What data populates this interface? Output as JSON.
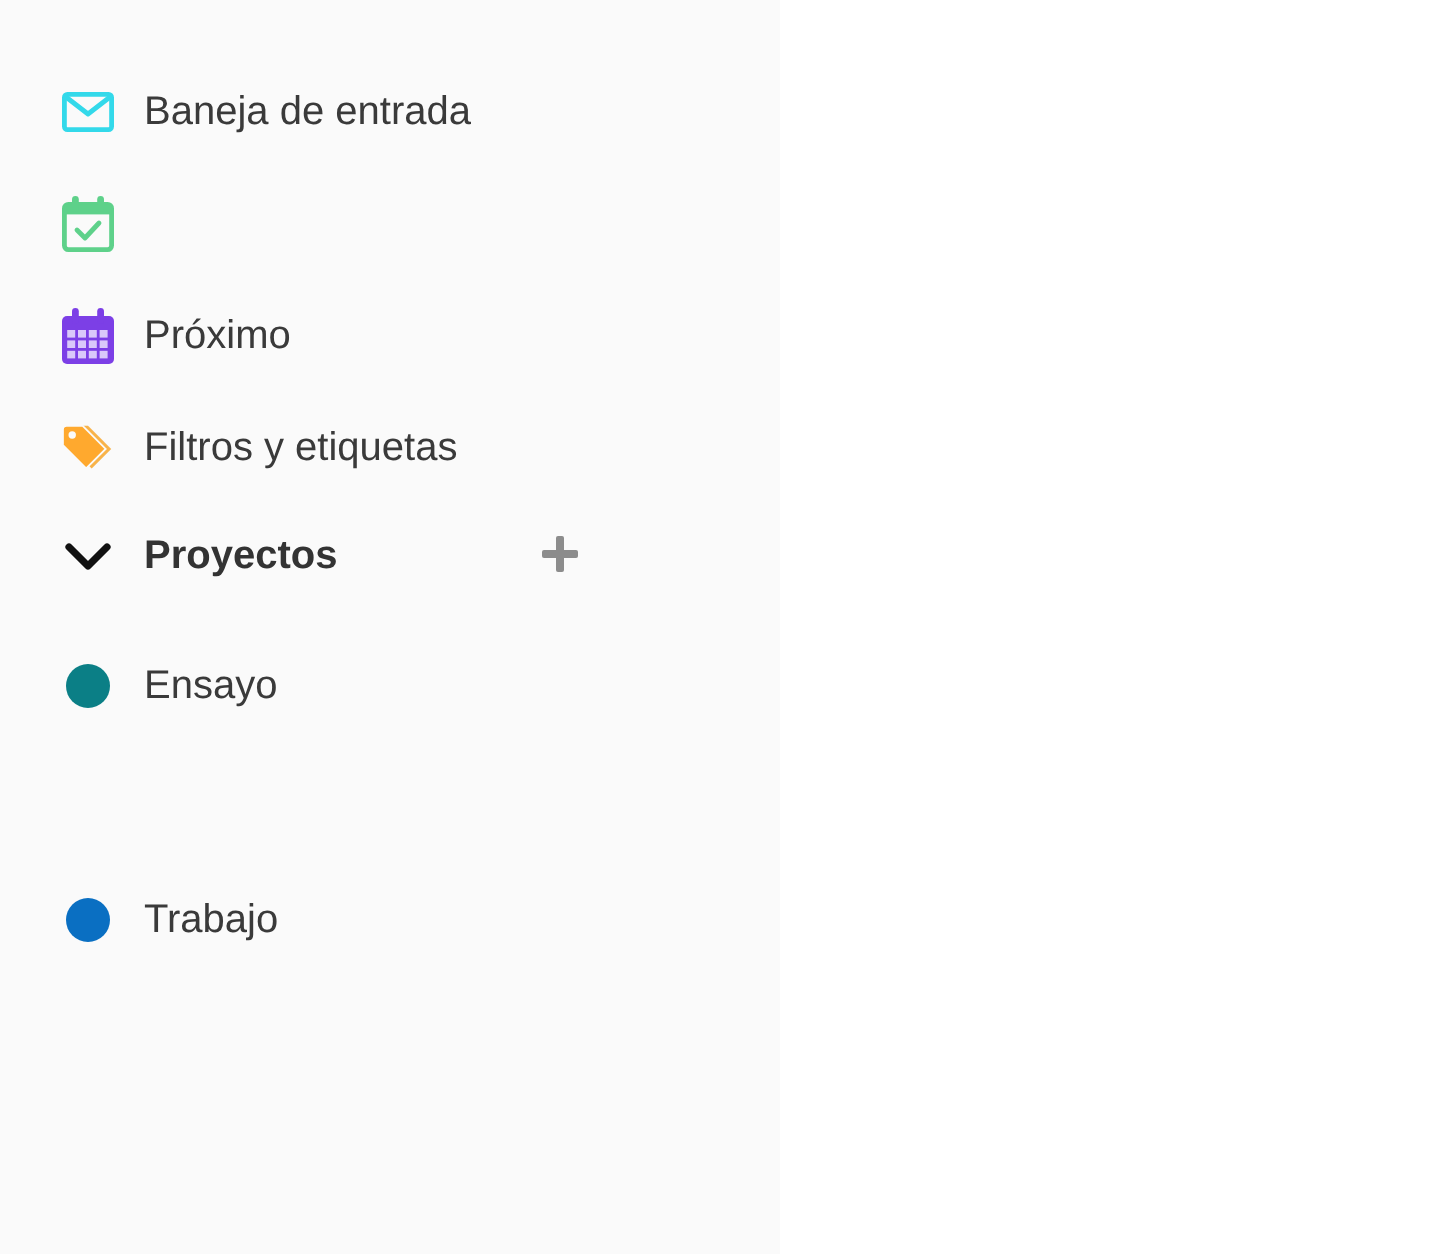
{
  "sidebar": {
    "nav_items": [
      {
        "kind": "inbox",
        "label": "Baneja de entrada"
      },
      {
        "kind": "today"
      },
      {
        "kind": "upcoming",
        "label": "Próximo"
      },
      {
        "kind": "filters",
        "label": "Filtros y etiquetas"
      }
    ],
    "projects": {
      "title": "Proyectos",
      "expanded": true,
      "items": [
        {
          "name": "Ensayo",
          "color": "#0b7f86"
        },
        {
          "name": "Trabajo",
          "color": "#0a6fc2"
        }
      ]
    }
  }
}
